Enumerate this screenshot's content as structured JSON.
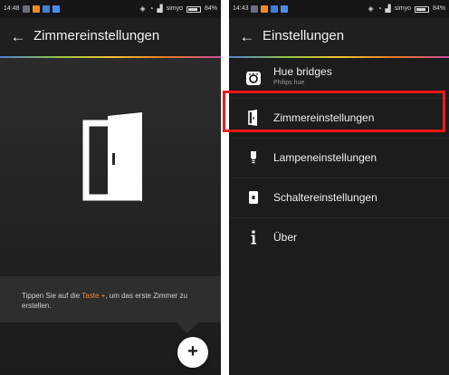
{
  "left_screen": {
    "status": {
      "time": "14:48",
      "carrier": "simyo",
      "battery_text": "84%",
      "battery_level": 0.84,
      "notif_colors": [
        "#6a6f7d",
        "#f08a24",
        "#3d82d6",
        "#4a8df0"
      ]
    },
    "appbar": {
      "back_icon": "arrow-left-icon",
      "title": "Zimmereinstellungen"
    },
    "illustration": {
      "icon": "door-open-icon"
    },
    "hint": {
      "text_before": "Tippen Sie auf die ",
      "accent": "Taste +",
      "text_after": ", um das erste Zimmer zu erstellen.",
      "accent_color": "#f08a24"
    },
    "fab": {
      "label": "+",
      "icon": "plus-icon"
    }
  },
  "right_screen": {
    "status": {
      "time": "14:43",
      "carrier": "simyo",
      "battery_text": "84%",
      "battery_level": 0.84,
      "notif_colors": [
        "#6a6f7d",
        "#f08a24",
        "#3d82d6",
        "#4a8df0"
      ]
    },
    "appbar": {
      "back_icon": "arrow-left-icon",
      "title": "Einstellungen"
    },
    "menu": [
      {
        "label": "Hue bridges",
        "sublabel": "Philips hue",
        "icon": "bridge-icon"
      },
      {
        "label": "Zimmereinstellungen",
        "icon": "door-icon",
        "highlighted": true
      },
      {
        "label": "Lampeneinstellungen",
        "icon": "lamp-icon"
      },
      {
        "label": "Schaltereinstellungen",
        "icon": "switch-icon"
      },
      {
        "label": "Über",
        "icon": "info-icon"
      }
    ],
    "highlight_color": "#f01818"
  }
}
